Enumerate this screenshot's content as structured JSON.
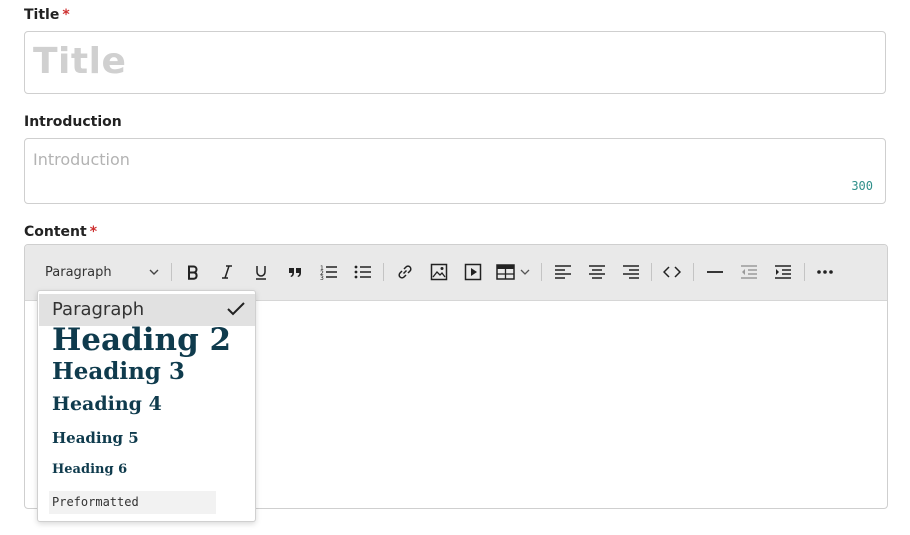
{
  "title_field": {
    "label": "Title",
    "required_mark": "*",
    "placeholder": "Title"
  },
  "introduction_field": {
    "label": "Introduction",
    "placeholder": "Introduction",
    "char_counter": "300"
  },
  "content_field": {
    "label": "Content",
    "required_mark": "*",
    "toolbar": {
      "block_format_selected": "Paragraph",
      "buttons": [
        "bold-icon",
        "italic-icon",
        "underline-icon",
        "blockquote-icon",
        "numbered-list-icon",
        "bulleted-list-icon",
        "link-icon",
        "image-icon",
        "media-embed-icon",
        "table-icon",
        "align-left-icon",
        "align-center-icon",
        "align-right-icon",
        "code-block-icon",
        "horizontal-line-icon",
        "outdent-icon",
        "indent-icon",
        "more-icon"
      ]
    },
    "block_format_dropdown": {
      "options": [
        "Paragraph",
        "Heading 2",
        "Heading 3",
        "Heading 4",
        "Heading 5",
        "Heading 6",
        "Preformatted"
      ],
      "selected": "Paragraph"
    }
  },
  "colors": {
    "required": "#cd2f2f",
    "heading_text": "#0f3b4d",
    "counter": "#2f8f8a",
    "toolbar_bg": "#e9e9e9"
  }
}
